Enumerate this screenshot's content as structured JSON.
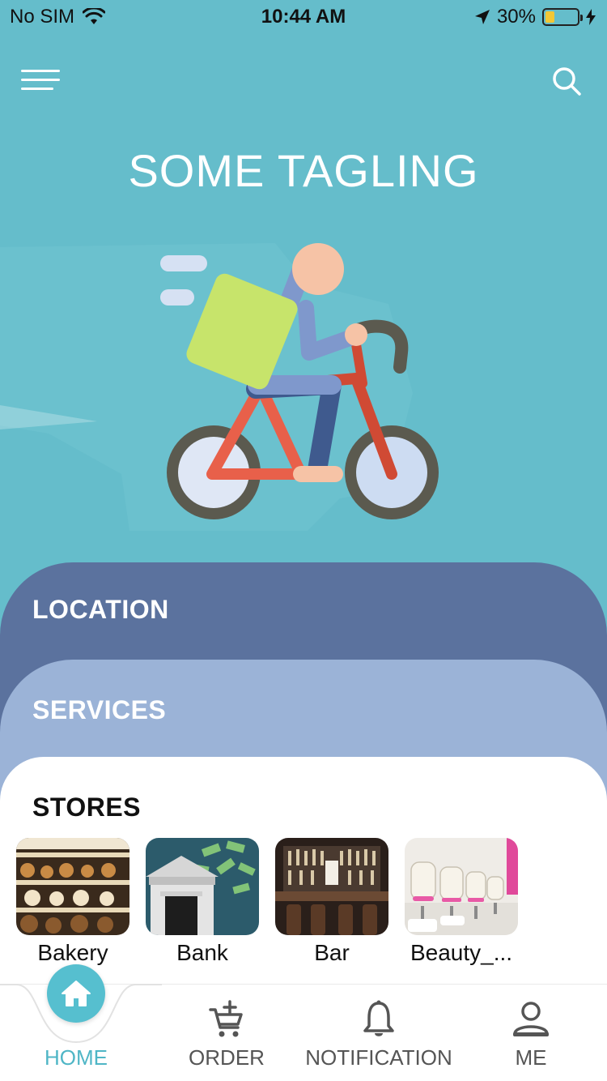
{
  "status_bar": {
    "carrier": "No SIM",
    "time": "10:44 AM",
    "battery_percent": "30%",
    "battery_level": 0.3
  },
  "header": {
    "menu_icon": "hamburger-menu-icon",
    "search_icon": "search-icon",
    "tagline": "SOME TAGLING"
  },
  "illustration": {
    "subject": "delivery-cyclist"
  },
  "sections": {
    "location": "LOCATION",
    "services": "SERVICES",
    "stores": "STORES"
  },
  "stores": [
    {
      "label": "Bakery"
    },
    {
      "label": "Bank"
    },
    {
      "label": "Bar"
    },
    {
      "label": "Beauty_..."
    }
  ],
  "tabs": [
    {
      "label": "HOME",
      "icon": "home-icon",
      "active": true
    },
    {
      "label": "ORDER",
      "icon": "cart-add-icon"
    },
    {
      "label": "NOTIFICATION",
      "icon": "bell-icon"
    },
    {
      "label": "ME",
      "icon": "user-icon"
    }
  ],
  "colors": {
    "background": "#65bdcb",
    "location_card": "#5b729e",
    "services_card": "#9bb3d7",
    "accent": "#56bfcf"
  }
}
